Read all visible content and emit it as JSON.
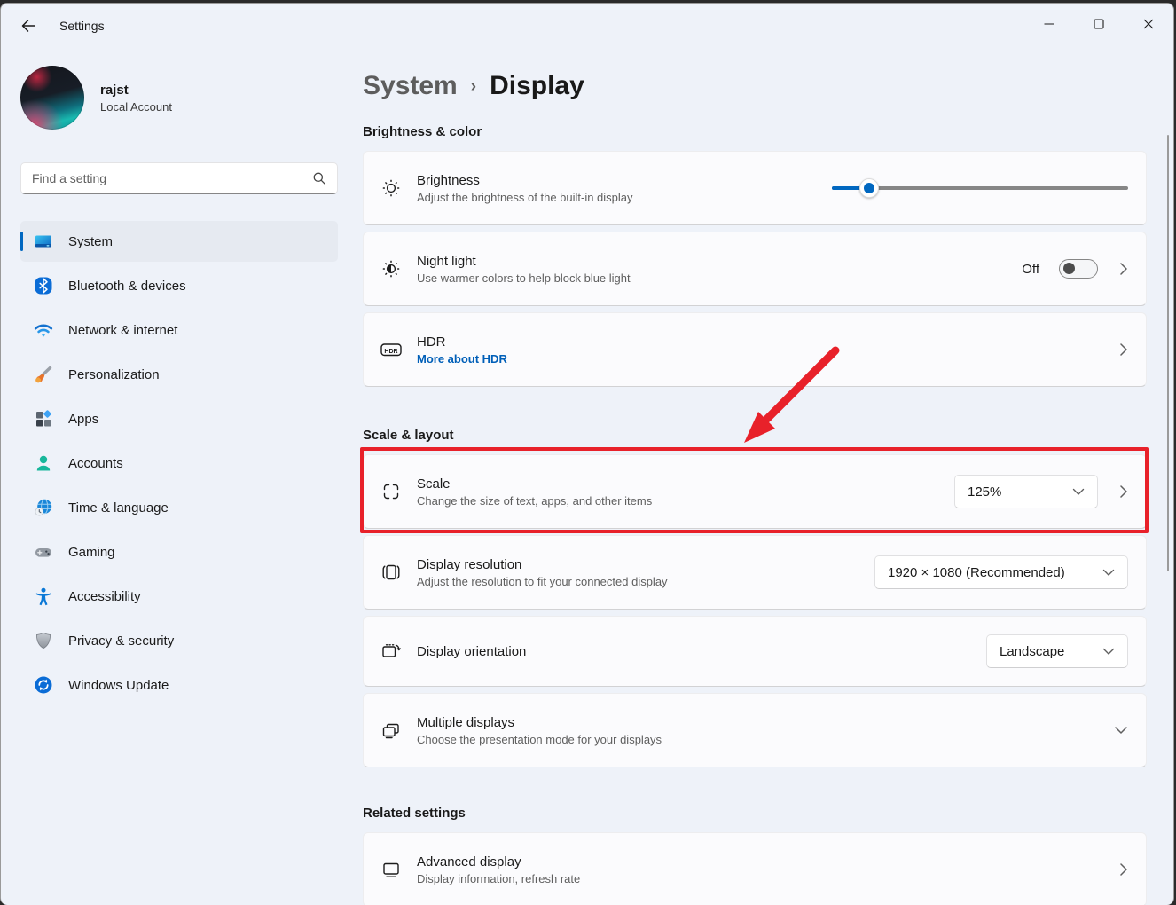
{
  "titlebar": {
    "app_title": "Settings"
  },
  "user": {
    "name": "rajst",
    "account_type": "Local Account"
  },
  "search": {
    "placeholder": "Find a setting"
  },
  "sidebar": {
    "items": [
      {
        "label": "System",
        "icon": "system-icon",
        "selected": true
      },
      {
        "label": "Bluetooth & devices",
        "icon": "bluetooth-icon",
        "selected": false
      },
      {
        "label": "Network & internet",
        "icon": "network-icon",
        "selected": false
      },
      {
        "label": "Personalization",
        "icon": "personalization-icon",
        "selected": false
      },
      {
        "label": "Apps",
        "icon": "apps-icon",
        "selected": false
      },
      {
        "label": "Accounts",
        "icon": "accounts-icon",
        "selected": false
      },
      {
        "label": "Time & language",
        "icon": "time-language-icon",
        "selected": false
      },
      {
        "label": "Gaming",
        "icon": "gaming-icon",
        "selected": false
      },
      {
        "label": "Accessibility",
        "icon": "accessibility-icon",
        "selected": false
      },
      {
        "label": "Privacy & security",
        "icon": "privacy-security-icon",
        "selected": false
      },
      {
        "label": "Windows Update",
        "icon": "windows-update-icon",
        "selected": false
      }
    ]
  },
  "breadcrumb": {
    "parent": "System",
    "separator": "›",
    "current": "Display"
  },
  "sections": {
    "brightness_color": "Brightness & color",
    "scale_layout": "Scale & layout",
    "related": "Related settings"
  },
  "rows": {
    "brightness": {
      "title": "Brightness",
      "subtitle": "Adjust the brightness of the built-in display",
      "value_percent": 12.6
    },
    "night_light": {
      "title": "Night light",
      "subtitle": "Use warmer colors to help block blue light",
      "state_label": "Off",
      "toggle_state": "off"
    },
    "hdr": {
      "title": "HDR",
      "link_label": "More about HDR"
    },
    "scale": {
      "title": "Scale",
      "subtitle": "Change the size of text, apps, and other items",
      "value": "125%",
      "highlighted": true
    },
    "resolution": {
      "title": "Display resolution",
      "subtitle": "Adjust the resolution to fit your connected display",
      "value": "1920 × 1080 (Recommended)"
    },
    "orientation": {
      "title": "Display orientation",
      "value": "Landscape"
    },
    "multiple_displays": {
      "title": "Multiple displays",
      "subtitle": "Choose the presentation mode for your displays"
    },
    "advanced_display": {
      "title": "Advanced display",
      "subtitle": "Display information, refresh rate"
    }
  },
  "colors": {
    "accent_blue": "#0067c0",
    "link_blue": "#005fb8",
    "annotation_red": "#e8212a"
  }
}
